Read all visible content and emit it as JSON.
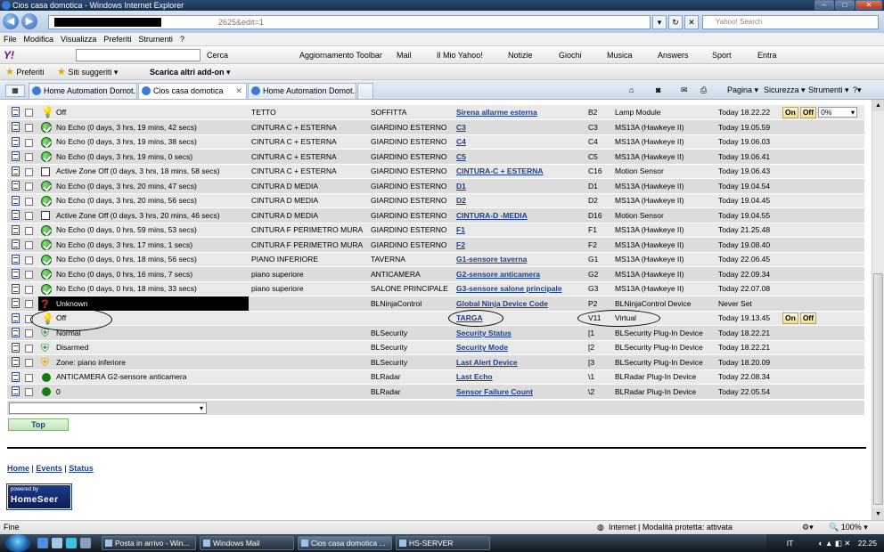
{
  "window": {
    "title": "Cios casa domotica - Windows Internet Explorer",
    "address_suffix": "2625&edit=1",
    "search_placeholder": "Yahoo! Search"
  },
  "menu": [
    "File",
    "Modifica",
    "Visualizza",
    "Preferiti",
    "Strumenti",
    "?"
  ],
  "toolbar": {
    "search_btn": "Cerca",
    "items": [
      "Aggiornamento Toolbar",
      "Mail",
      "Il Mio Yahoo!",
      "Notizie",
      "Giochi",
      "Musica",
      "Answers",
      "Sport",
      "Entra"
    ]
  },
  "favorites": {
    "label": "Preferiti",
    "items": [
      "Siti suggeriti ▾",
      "Scarica altri add-on ▾"
    ]
  },
  "tabs": [
    {
      "label": "Home Automation Domot..."
    },
    {
      "label": "Cios casa domotica"
    },
    {
      "label": "Home Automation Domot..."
    }
  ],
  "commands": [
    "Pagina ▾",
    "Sicurezza ▾",
    "Strumenti ▾"
  ],
  "on_label": "On",
  "off_label": "Off",
  "dim_value": "0%",
  "devices": [
    {
      "icon": "bulb",
      "status": "Off",
      "location": "TETTO",
      "location2": "SOFFITTA",
      "name": "Sirena allarme esterna",
      "code": "B2",
      "type": "Lamp Module",
      "last_change": "Today 18.22.22",
      "control": "onoff-dim"
    },
    {
      "icon": "green",
      "status": "No Echo (0 days, 3 hrs, 19 mins, 42 secs)",
      "location": "CINTURA C + ESTERNA",
      "location2": "GIARDINO ESTERNO",
      "name": "C3",
      "code": "C3",
      "type": "MS13A (Hawkeye II)",
      "last_change": "Today 19.05.59",
      "control": ""
    },
    {
      "icon": "green",
      "status": "No Echo (0 days, 3 hrs, 19 mins, 38 secs)",
      "location": "CINTURA C + ESTERNA",
      "location2": "GIARDINO ESTERNO",
      "name": "C4",
      "code": "C4",
      "type": "MS13A (Hawkeye II)",
      "last_change": "Today 19.06.03",
      "control": ""
    },
    {
      "icon": "green",
      "status": "No Echo (0 days, 3 hrs, 19 mins, 0 secs)",
      "location": "CINTURA C + ESTERNA",
      "location2": "GIARDINO ESTERNO",
      "name": "C5",
      "code": "C5",
      "type": "MS13A (Hawkeye II)",
      "last_change": "Today 19.06.41",
      "control": ""
    },
    {
      "icon": "frame",
      "status": "Active Zone Off (0 days, 3 hrs, 18 mins, 58 secs)",
      "location": "CINTURA C + ESTERNA",
      "location2": "GIARDINO ESTERNO",
      "name": "CINTURA-C + ESTERNA",
      "code": "C16",
      "type": "Motion Sensor",
      "last_change": "Today 19.06.43",
      "control": ""
    },
    {
      "icon": "green",
      "status": "No Echo (0 days, 3 hrs, 20 mins, 47 secs)",
      "location": "CINTURA D MEDIA",
      "location2": "GIARDINO ESTERNO",
      "name": "D1",
      "code": "D1",
      "type": "MS13A (Hawkeye II)",
      "last_change": "Today 19.04.54",
      "control": ""
    },
    {
      "icon": "green",
      "status": "No Echo (0 days, 3 hrs, 20 mins, 56 secs)",
      "location": "CINTURA D MEDIA",
      "location2": "GIARDINO ESTERNO",
      "name": "D2",
      "code": "D2",
      "type": "MS13A (Hawkeye II)",
      "last_change": "Today 19.04.45",
      "control": ""
    },
    {
      "icon": "frame",
      "status": "Active Zone Off (0 days, 3 hrs, 20 mins, 46 secs)",
      "location": "CINTURA D MEDIA",
      "location2": "GIARDINO ESTERNO",
      "name": "CINTURA-D -MEDIA",
      "code": "D16",
      "type": "Motion Sensor",
      "last_change": "Today 19.04.55",
      "control": ""
    },
    {
      "icon": "green",
      "status": "No Echo (0 days, 0 hrs, 59 mins, 53 secs)",
      "location": "CINTURA F PERIMETRO MURA",
      "location2": "GIARDINO ESTERNO",
      "name": "F1",
      "code": "F1",
      "type": "MS13A (Hawkeye II)",
      "last_change": "Today 21.25.48",
      "control": ""
    },
    {
      "icon": "green",
      "status": "No Echo (0 days, 3 hrs, 17 mins, 1 secs)",
      "location": "CINTURA F PERIMETRO MURA",
      "location2": "GIARDINO ESTERNO",
      "name": "F2",
      "code": "F2",
      "type": "MS13A (Hawkeye II)",
      "last_change": "Today 19.08.40",
      "control": ""
    },
    {
      "icon": "green",
      "status": "No Echo (0 days, 0 hrs, 18 mins, 56 secs)",
      "location": "PIANO INFERIORE",
      "location2": "TAVERNA",
      "name": "G1-sensore taverna",
      "code": "G1",
      "type": "MS13A (Hawkeye II)",
      "last_change": "Today 22.06.45",
      "control": ""
    },
    {
      "icon": "green",
      "status": "No Echo (0 days, 0 hrs, 16 mins, 7 secs)",
      "location": "piano superiore",
      "location2": "ANTICAMERA",
      "name": "G2-sensore anticamera",
      "code": "G2",
      "type": "MS13A (Hawkeye II)",
      "last_change": "Today 22.09.34",
      "control": ""
    },
    {
      "icon": "green",
      "status": "No Echo (0 days, 0 hrs, 18 mins, 33 secs)",
      "location": "piano superiore",
      "location2": "SALONE PRINCIPALE",
      "name": "G3-sensore salone principale",
      "code": "G3",
      "type": "MS13A (Hawkeye II)",
      "last_change": "Today 22.07.08",
      "control": ""
    },
    {
      "icon": "q",
      "status": "Unknown",
      "location": "",
      "location2": "BLNinjaControl",
      "name": "Global Ninja Device Code",
      "code": "P2",
      "type": "BLNinjaControl Device",
      "last_change": "Never Set",
      "control": "",
      "black": true
    },
    {
      "icon": "bulb",
      "status": "Off",
      "location": "",
      "location2": "",
      "name": "TARGA",
      "code": "V11",
      "type": "Virtual",
      "last_change": "Today 19.13.45",
      "control": "onoff"
    },
    {
      "icon": "shield",
      "status": "Normal",
      "location": "",
      "location2": "BLSecurity",
      "name": "Security Status",
      "code": "[1",
      "type": "BLSecurity Plug-In Device",
      "last_change": "Today 18.22.21",
      "control": ""
    },
    {
      "icon": "shield",
      "status": "Disarmed",
      "location": "",
      "location2": "BLSecurity",
      "name": "Security Mode",
      "code": "[2",
      "type": "BLSecurity Plug-In Device",
      "last_change": "Today 18.22.21",
      "control": ""
    },
    {
      "icon": "shield-y",
      "status": "Zone: piano inferiore",
      "location": "",
      "location2": "BLSecurity",
      "name": "Last Alert Device",
      "code": "[3",
      "type": "BLSecurity Plug-In Device",
      "last_change": "Today 18.20.09",
      "control": ""
    },
    {
      "icon": "dot",
      "status": "ANTICAMERA G2-sensore anticamera",
      "location": "",
      "location2": "BLRadar",
      "name": "Last Echo",
      "code": "\\1",
      "type": "BLRadar Plug-In Device",
      "last_change": "Today 22.08.34",
      "control": ""
    },
    {
      "icon": "dot",
      "status": "0",
      "location": "",
      "location2": "BLRadar",
      "name": "Sensor Failure Count",
      "code": "\\2",
      "type": "BLRadar Plug-In Device",
      "last_change": "Today 22.05.54",
      "control": ""
    }
  ],
  "top_button": "Top",
  "footer_links": [
    "Home",
    "Events",
    "Status"
  ],
  "powered_by": {
    "line1": "powered by",
    "line2": "HomeSeer"
  },
  "status": {
    "left": "Fine",
    "zone": "Internet | Modalità protetta: attivata",
    "zoom": "100%"
  },
  "taskbar": {
    "buttons": [
      "Posta in arrivo - Win...",
      "Windows Mail",
      "Cios casa domotica ...",
      "HS-SERVER"
    ],
    "lang": "IT",
    "clock": "22.25"
  }
}
